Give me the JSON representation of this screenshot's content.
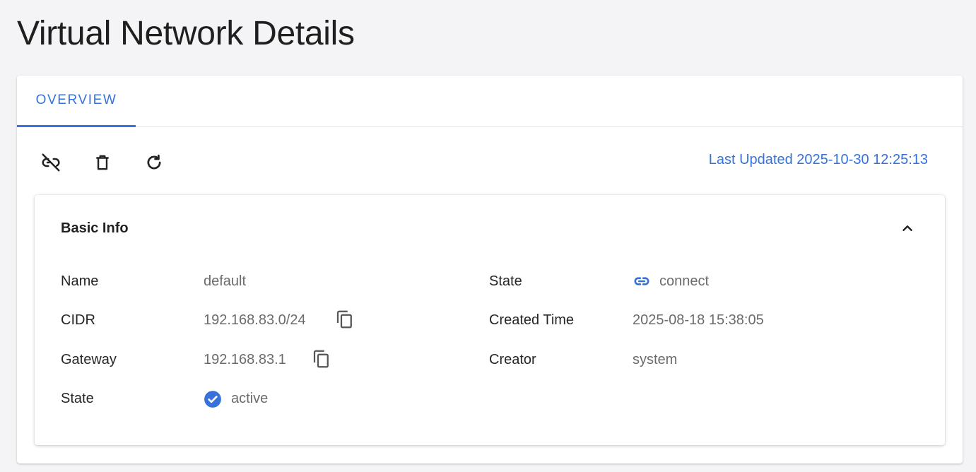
{
  "page": {
    "title": "Virtual Network Details"
  },
  "tabs": [
    {
      "label": "OVERVIEW",
      "active": true
    }
  ],
  "toolbar": {
    "icons": [
      "link-off-icon",
      "trash-icon",
      "refresh-icon"
    ],
    "last_updated": "Last Updated 2025-10-30 12:25:13"
  },
  "basic_info": {
    "title": "Basic Info",
    "left": [
      {
        "label": "Name",
        "value": "default"
      },
      {
        "label": "CIDR",
        "value": "192.168.83.0/24"
      },
      {
        "label": "Gateway",
        "value": "192.168.83.1"
      },
      {
        "label": "State",
        "value": "active"
      }
    ],
    "right": [
      {
        "label": "State",
        "value": "connect"
      },
      {
        "label": "Created Time",
        "value": "2025-08-18 15:38:05"
      },
      {
        "label": "Creator",
        "value": "system"
      }
    ]
  },
  "colors": {
    "accent": "#3672d9",
    "background": "#f4f4f6"
  }
}
